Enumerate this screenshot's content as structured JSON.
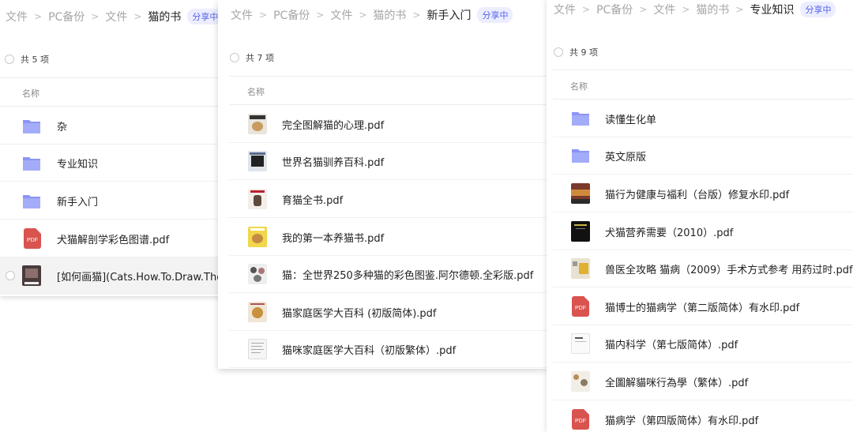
{
  "panel1": {
    "breadcrumb": [
      "文件",
      "PC备份",
      "文件",
      "猫的书"
    ],
    "badge": "分享中",
    "count": "共 5 项",
    "column_header": "名称",
    "items": [
      {
        "type": "folder",
        "name": "杂"
      },
      {
        "type": "folder",
        "name": "专业知识"
      },
      {
        "type": "folder",
        "name": "新手入门"
      },
      {
        "type": "pdf",
        "name": "犬猫解剖学彩色图谱.pdf"
      },
      {
        "type": "thumb",
        "name": "[如何画猫](Cats.How.To.Draw.Them).pdf"
      }
    ]
  },
  "panel2": {
    "breadcrumb": [
      "文件",
      "PC备份",
      "文件",
      "猫的书",
      "新手入门"
    ],
    "badge": "分享中",
    "count": "共 7 项",
    "column_header": "名称",
    "items": [
      {
        "type": "thumb",
        "name": "完全图解猫的心理.pdf"
      },
      {
        "type": "thumb",
        "name": "世界名猫驯养百科.pdf"
      },
      {
        "type": "thumb",
        "name": "育猫全书.pdf"
      },
      {
        "type": "thumb",
        "name": "我的第一本养猫书.pdf"
      },
      {
        "type": "thumb",
        "name": "猫：全世界250多种猫的彩色图鉴.阿尔德顿.全彩版.pdf"
      },
      {
        "type": "thumb",
        "name": "猫家庭医学大百科 (初版简体).pdf"
      },
      {
        "type": "thumb",
        "name": "猫咪家庭医学大百科（初版繁体）.pdf"
      }
    ]
  },
  "panel3": {
    "breadcrumb": [
      "文件",
      "PC备份",
      "文件",
      "猫的书",
      "专业知识"
    ],
    "badge": "分享中",
    "count": "共 9 项",
    "column_header": "名称",
    "items": [
      {
        "type": "folder",
        "name": "读懂生化单"
      },
      {
        "type": "folder",
        "name": "英文原版"
      },
      {
        "type": "thumb",
        "name": "猫行为健康与福利（台版）修复水印.pdf"
      },
      {
        "type": "thumb",
        "name": "犬猫营养需要（2010）.pdf"
      },
      {
        "type": "thumb",
        "name": "兽医全攻略 猫病（2009）手术方式参考 用药过时.pdf"
      },
      {
        "type": "pdf",
        "name": "猫博士的猫病学（第二版简体）有水印.pdf"
      },
      {
        "type": "thumb",
        "name": "猫内科学（第七版简体）.pdf"
      },
      {
        "type": "thumb",
        "name": "全圖解貓咪行為學（繁体）.pdf"
      },
      {
        "type": "pdf",
        "name": "猫病学（第四版简体）有水印.pdf"
      }
    ]
  },
  "icons": {
    "folder": "folder-icon",
    "pdf": "pdf-file-icon",
    "thumb": "book-cover-thumbnail",
    "radio": "select-all-radio",
    "chevron": "chevron-right-icon"
  },
  "colors": {
    "folder": "#8b95f5",
    "pdf": "#d9534f",
    "badge_bg": "#eceeff",
    "badge_text": "#5461e8"
  }
}
